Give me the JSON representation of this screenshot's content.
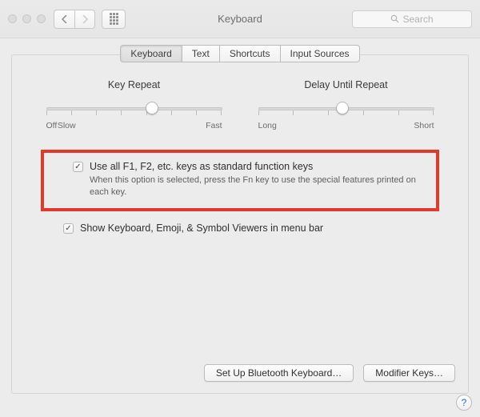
{
  "window": {
    "title": "Keyboard",
    "search_placeholder": "Search"
  },
  "tabs": {
    "items": [
      {
        "label": "Keyboard",
        "active": true
      },
      {
        "label": "Text",
        "active": false
      },
      {
        "label": "Shortcuts",
        "active": false
      },
      {
        "label": "Input Sources",
        "active": false
      }
    ]
  },
  "sliders": {
    "key_repeat": {
      "title": "Key Repeat",
      "left_label": "Off",
      "mid_label": "Slow",
      "right_label": "Fast",
      "position_pct": 60
    },
    "delay_repeat": {
      "title": "Delay Until Repeat",
      "left_label": "Long",
      "right_label": "Short",
      "position_pct": 48
    }
  },
  "options": {
    "fn_keys": {
      "checked": true,
      "label": "Use all F1, F2, etc. keys as standard function keys",
      "subtext": "When this option is selected, press the Fn key to use the special features printed on each key."
    },
    "show_viewers": {
      "checked": true,
      "label": "Show Keyboard, Emoji, & Symbol Viewers in menu bar"
    }
  },
  "buttons": {
    "bluetooth": "Set Up Bluetooth Keyboard…",
    "modifier": "Modifier Keys…"
  }
}
